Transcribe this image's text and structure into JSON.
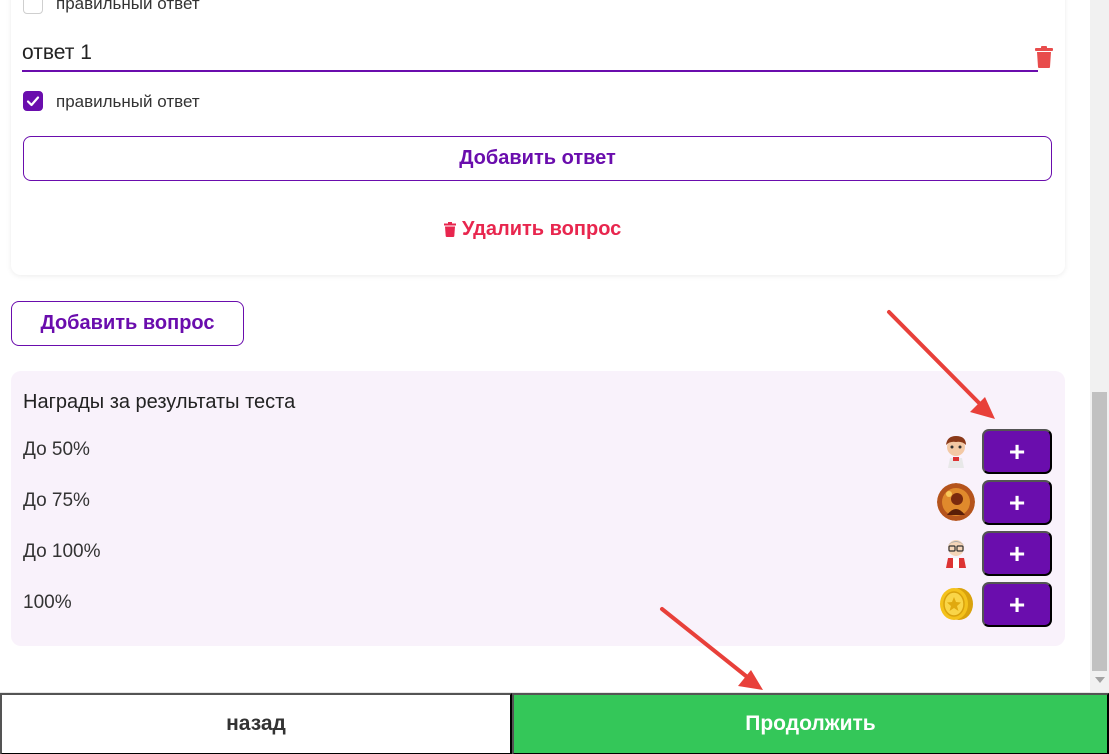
{
  "question_card": {
    "prev_answer_checkbox_label": "правильный ответ",
    "answer_input_value": "ответ 1",
    "correct_checkbox_label": "правильный ответ",
    "correct_checked": true,
    "add_answer_label": "Добавить ответ",
    "delete_question_label": "Удалить вопрос"
  },
  "add_question_label": "Добавить вопрос",
  "rewards": {
    "title": "Награды за результаты теста",
    "rows": [
      {
        "label": "До 50%",
        "avatar": "avatar-boy-icon",
        "button": "+"
      },
      {
        "label": "До 75%",
        "avatar": "avatar-warrior-icon",
        "button": "+"
      },
      {
        "label": "До 100%",
        "avatar": "avatar-nerd-icon",
        "button": "+"
      },
      {
        "label": "100%",
        "avatar": "coins-icon",
        "button": "+"
      }
    ]
  },
  "footer": {
    "back_label": "назад",
    "continue_label": "Продолжить"
  },
  "colors": {
    "accent": "#6a0dad",
    "danger": "#e8264e",
    "success": "#34c759",
    "rewards_bg": "#f9f2fb",
    "annotation_arrow": "#e8403a"
  }
}
